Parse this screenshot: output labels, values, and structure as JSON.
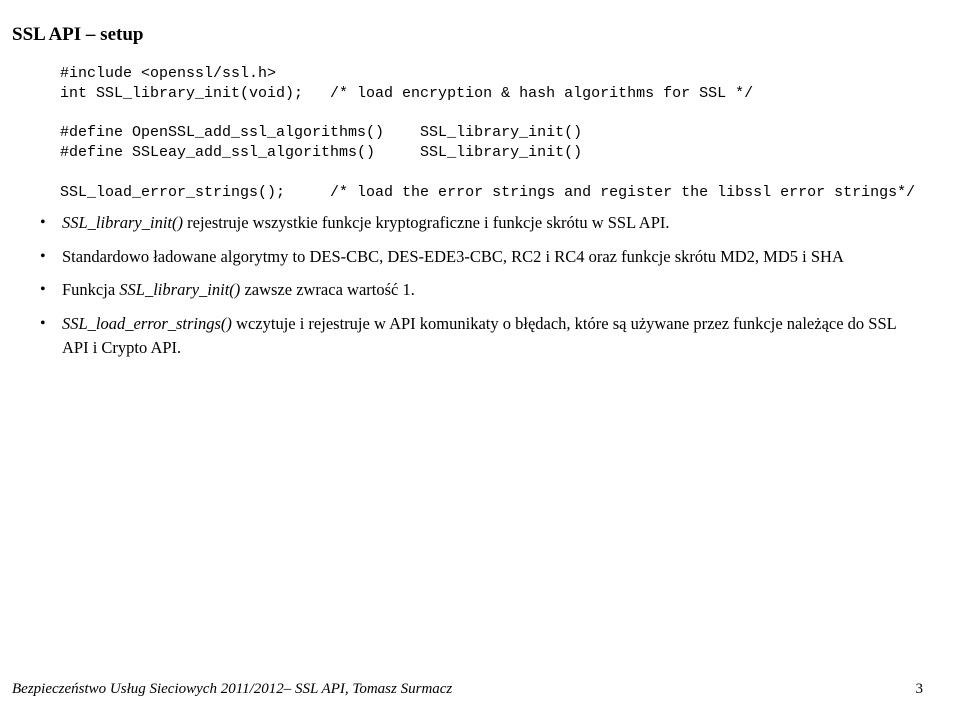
{
  "section_title": "SSL API – setup",
  "code": {
    "l1": "#include <openssl/ssl.h>",
    "l2": "int SSL_library_init(void);   /* load encryption & hash algorithms for SSL */",
    "l3": "#define OpenSSL_add_ssl_algorithms()    SSL_library_init()",
    "l4": "#define SSLeay_add_ssl_algorithms()     SSL_library_init()",
    "l5": "SSL_load_error_strings();     /* load the error strings and register the libssl error strings*/"
  },
  "bullets": {
    "b1_fn": "SSL_library_init()",
    "b1_rest": " rejestruje wszystkie funkcje kryptograficzne i funkcje skrótu w SSL API.",
    "b2": "Standardowo ładowane algorytmy to DES-CBC, DES-EDE3-CBC, RC2 i RC4 oraz funkcje skrótu MD2, MD5 i SHA",
    "b3_pre": "Funkcja ",
    "b3_fn": "SSL_library_init()",
    "b3_post": " zawsze zwraca wartość 1.",
    "b4_fn": "SSL_load_error_strings()",
    "b4_rest": " wczytuje i rejestruje w API komunikaty o błędach, które są używane przez funkcje należące do SSL API i Crypto API."
  },
  "footer": {
    "left": "Bezpieczeństwo Usług Sieciowych 2011/2012– SSL API, Tomasz Surmacz",
    "page": "3"
  }
}
